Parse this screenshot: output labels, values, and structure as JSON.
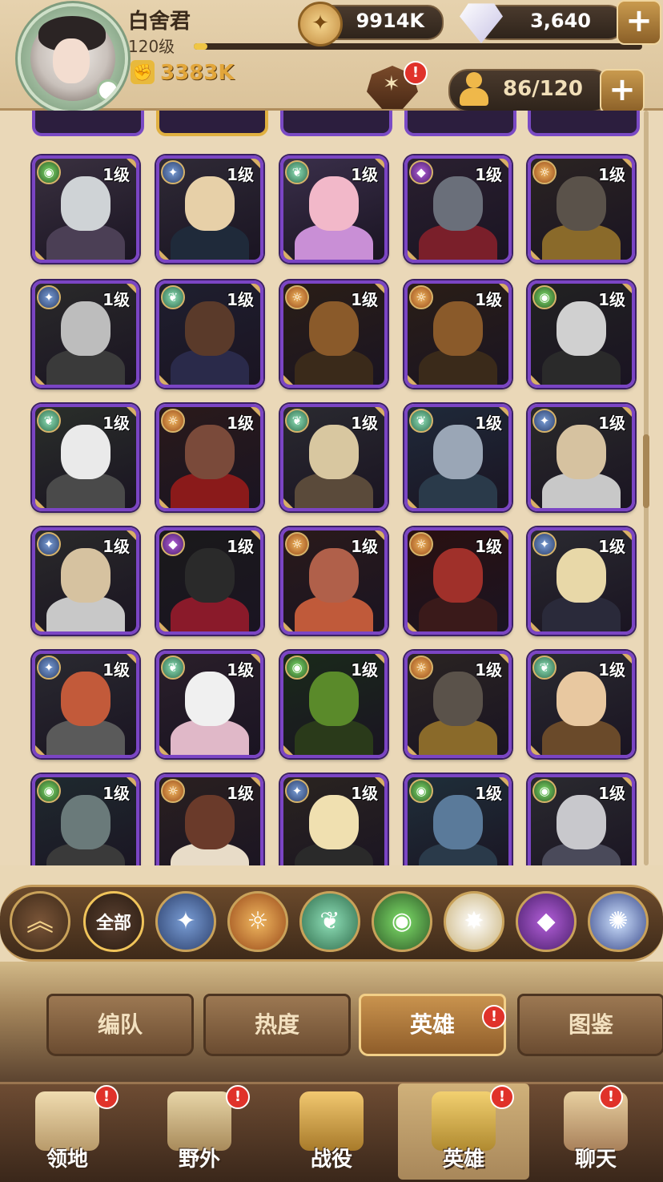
{
  "player": {
    "name": "白舍君",
    "level": "120级",
    "power": "3383K",
    "exp_fraction": 0.03
  },
  "resources": {
    "gold": "9914K",
    "gems": "3,640"
  },
  "hero_count": "86/120",
  "colors": {
    "frame_purple": "#7b45c4",
    "frame_gold": "#e0b040",
    "badge_red": "#e0322a",
    "accent_gold": "#e2a63a"
  },
  "heroes": [
    {
      "faction": "eye-icon",
      "level": "1级"
    },
    {
      "faction": "star-icon",
      "level": "1级"
    },
    {
      "faction": "leaf-icon",
      "level": "1级"
    },
    {
      "faction": "demon-icon",
      "level": "1级"
    },
    {
      "faction": "sun-icon",
      "level": "1级"
    },
    {
      "faction": "star-icon",
      "level": "1级"
    },
    {
      "faction": "leaf-icon",
      "level": "1级"
    },
    {
      "faction": "sun-icon",
      "level": "1级"
    },
    {
      "faction": "sun-icon",
      "level": "1级"
    },
    {
      "faction": "eye-icon",
      "level": "1级"
    },
    {
      "faction": "leaf-icon",
      "level": "1级"
    },
    {
      "faction": "sun-icon",
      "level": "1级"
    },
    {
      "faction": "leaf-icon",
      "level": "1级"
    },
    {
      "faction": "leaf-icon",
      "level": "1级"
    },
    {
      "faction": "star-icon",
      "level": "1级"
    },
    {
      "faction": "star-icon",
      "level": "1级"
    },
    {
      "faction": "demon-icon",
      "level": "1级"
    },
    {
      "faction": "sun-icon",
      "level": "1级"
    },
    {
      "faction": "sun-icon",
      "level": "1级"
    },
    {
      "faction": "star-icon",
      "level": "1级"
    },
    {
      "faction": "star-icon",
      "level": "1级"
    },
    {
      "faction": "leaf-icon",
      "level": "1级"
    },
    {
      "faction": "eye-icon",
      "level": "1级"
    },
    {
      "faction": "sun-icon",
      "level": "1级"
    },
    {
      "faction": "leaf-icon",
      "level": "1级"
    },
    {
      "faction": "eye-icon",
      "level": "1级"
    },
    {
      "faction": "sun-icon",
      "level": "1级"
    },
    {
      "faction": "star-icon",
      "level": "1级"
    },
    {
      "faction": "eye-icon",
      "level": "1级"
    },
    {
      "faction": "eye-icon",
      "level": "1级"
    }
  ],
  "filters": {
    "all_label": "全部",
    "factions": [
      "star-icon",
      "sun-icon",
      "leaf-icon",
      "eye-icon",
      "celestial-icon",
      "demon-icon",
      "dimensional-icon"
    ]
  },
  "tabs": [
    {
      "label": "编队",
      "active": false
    },
    {
      "label": "热度",
      "active": false
    },
    {
      "label": "英雄",
      "active": true
    },
    {
      "label": "图鉴",
      "active": false
    }
  ],
  "nav": [
    {
      "label": "领地",
      "icon": "castle-icon",
      "active": false
    },
    {
      "label": "野外",
      "icon": "map-scroll-icon",
      "active": false
    },
    {
      "label": "战役",
      "icon": "sword-crest-icon",
      "active": false
    },
    {
      "label": "英雄",
      "icon": "helmet-icon",
      "active": true
    },
    {
      "label": "聊天",
      "icon": "chat-icon",
      "active": false
    }
  ],
  "badges": {
    "mark": "!"
  }
}
